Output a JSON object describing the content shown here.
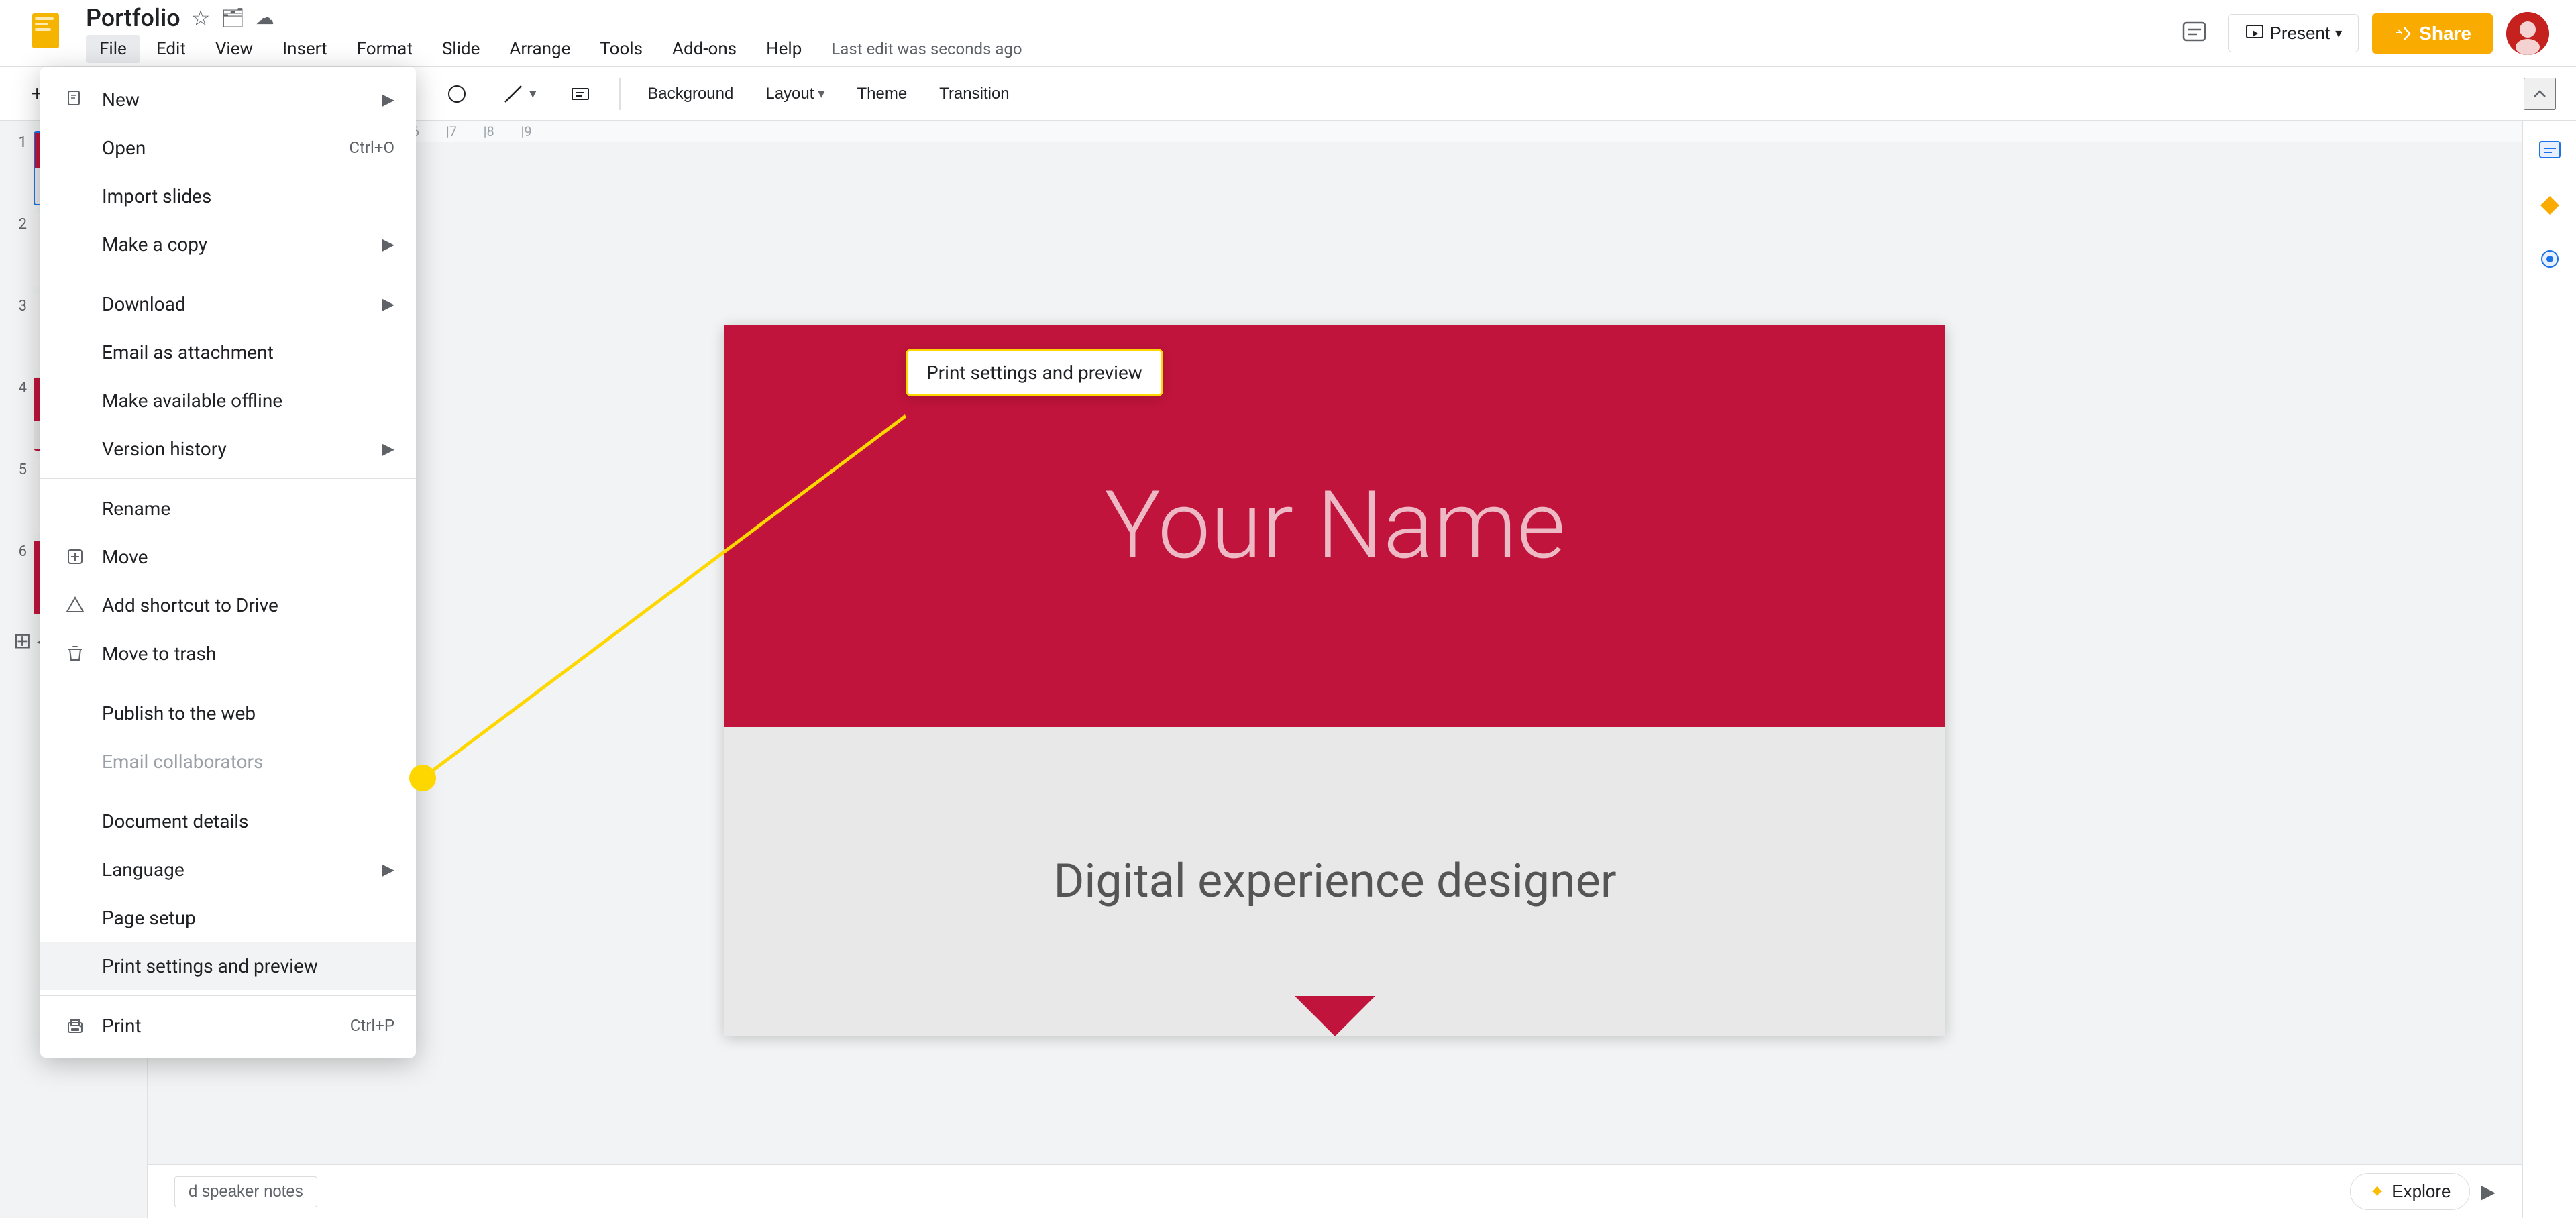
{
  "app": {
    "icon_color": "#f4b400",
    "title": "Portfolio",
    "last_edit": "Last edit was seconds ago"
  },
  "menu_bar": {
    "items": [
      {
        "label": "File",
        "active": true
      },
      {
        "label": "Edit"
      },
      {
        "label": "View"
      },
      {
        "label": "Insert"
      },
      {
        "label": "Format"
      },
      {
        "label": "Slide"
      },
      {
        "label": "Arrange"
      },
      {
        "label": "Tools"
      },
      {
        "label": "Add-ons"
      },
      {
        "label": "Help"
      }
    ]
  },
  "toolbar": {
    "background_label": "Background",
    "layout_label": "Layout",
    "theme_label": "Theme",
    "transition_label": "Transition"
  },
  "top_right": {
    "present_label": "Present",
    "share_label": "Share"
  },
  "file_menu": {
    "items": [
      {
        "id": "new",
        "label": "New",
        "shortcut": "",
        "has_arrow": true,
        "icon": "new",
        "disabled": false
      },
      {
        "id": "open",
        "label": "Open",
        "shortcut": "Ctrl+O",
        "has_arrow": false,
        "icon": "folder",
        "disabled": false
      },
      {
        "id": "import_slides",
        "label": "Import slides",
        "shortcut": "",
        "has_arrow": false,
        "icon": "",
        "disabled": false
      },
      {
        "id": "make_copy",
        "label": "Make a copy",
        "shortcut": "",
        "has_arrow": true,
        "icon": "",
        "disabled": false
      },
      {
        "id": "download",
        "label": "Download",
        "shortcut": "",
        "has_arrow": true,
        "icon": "",
        "disabled": false
      },
      {
        "id": "email_as_attachment",
        "label": "Email as attachment",
        "shortcut": "",
        "has_arrow": false,
        "icon": "",
        "disabled": false
      },
      {
        "id": "make_available_offline",
        "label": "Make available offline",
        "shortcut": "",
        "has_arrow": false,
        "icon": "",
        "disabled": false
      },
      {
        "id": "version_history",
        "label": "Version history",
        "shortcut": "",
        "has_arrow": true,
        "icon": "",
        "disabled": false
      },
      {
        "id": "rename",
        "label": "Rename",
        "shortcut": "",
        "has_arrow": false,
        "icon": "",
        "disabled": false
      },
      {
        "id": "move",
        "label": "Move",
        "shortcut": "",
        "has_arrow": false,
        "icon": "move",
        "disabled": false
      },
      {
        "id": "add_shortcut",
        "label": "Add shortcut to Drive",
        "shortcut": "",
        "has_arrow": false,
        "icon": "drive",
        "disabled": false
      },
      {
        "id": "move_to_trash",
        "label": "Move to trash",
        "shortcut": "",
        "has_arrow": false,
        "icon": "trash",
        "disabled": false
      },
      {
        "id": "publish_to_web",
        "label": "Publish to the web",
        "shortcut": "",
        "has_arrow": false,
        "icon": "",
        "disabled": false
      },
      {
        "id": "email_collaborators",
        "label": "Email collaborators",
        "shortcut": "",
        "has_arrow": false,
        "icon": "",
        "disabled": true
      },
      {
        "id": "document_details",
        "label": "Document details",
        "shortcut": "",
        "has_arrow": false,
        "icon": "",
        "disabled": false
      },
      {
        "id": "language",
        "label": "Language",
        "shortcut": "",
        "has_arrow": true,
        "icon": "",
        "disabled": false
      },
      {
        "id": "page_setup",
        "label": "Page setup",
        "shortcut": "",
        "has_arrow": false,
        "icon": "",
        "disabled": false
      },
      {
        "id": "print_settings",
        "label": "Print settings and preview",
        "shortcut": "",
        "has_arrow": false,
        "icon": "",
        "disabled": false,
        "highlighted": true
      },
      {
        "id": "print",
        "label": "Print",
        "shortcut": "Ctrl+P",
        "has_arrow": false,
        "icon": "print",
        "disabled": false
      }
    ]
  },
  "slide": {
    "title": "Your Name",
    "subtitle": "Digital experience designer"
  },
  "slides_panel": {
    "items": [
      {
        "num": "1",
        "active": true
      },
      {
        "num": "2",
        "active": false
      },
      {
        "num": "3",
        "active": false
      },
      {
        "num": "4",
        "active": false
      },
      {
        "num": "5",
        "active": false
      },
      {
        "num": "6",
        "active": false
      }
    ]
  },
  "bottom_bar": {
    "notes_label": "d speaker notes",
    "explore_label": "Explore"
  },
  "annotation": {
    "tooltip_text": "Print settings and preview",
    "target_text": "Print settings and preview"
  }
}
